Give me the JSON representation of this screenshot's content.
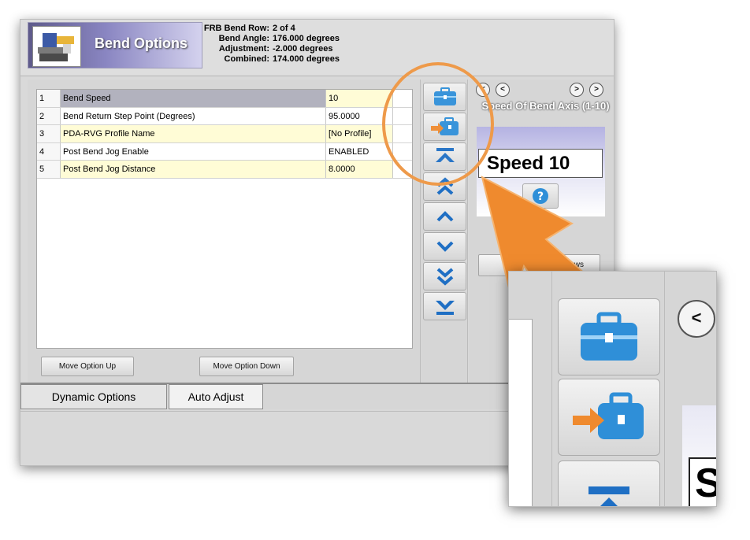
{
  "header": {
    "title": "Bend Options",
    "info": [
      {
        "label": "FRB Bend Row:",
        "value": "2 of 4"
      },
      {
        "label": "Bend Angle:",
        "value": "176.000 degrees"
      },
      {
        "label": "Adjustment:",
        "value": "-2.000 degrees"
      },
      {
        "label": "Combined:",
        "value": "174.000 degrees"
      }
    ]
  },
  "grid": {
    "rows": [
      {
        "num": "1",
        "name": "Bend Speed",
        "value": "10"
      },
      {
        "num": "2",
        "name": "Bend Return Step Point (Degrees)",
        "value": "95.0000"
      },
      {
        "num": "3",
        "name": "PDA-RVG Profile Name",
        "value": "[No Profile]"
      },
      {
        "num": "4",
        "name": "Post Bend Jog Enable",
        "value": "ENABLED"
      },
      {
        "num": "5",
        "name": "Post Bend Jog Distance",
        "value": "8.0000"
      }
    ]
  },
  "buttons": {
    "move_up": "Move Option Up",
    "move_down": "Move Option Down",
    "all_rows": "ll Rows"
  },
  "nav": {
    "prev_label": "<",
    "next_label": ">"
  },
  "param": {
    "title": "Speed Of Bend Axis (1-10)",
    "display": "Speed 10",
    "help": "?"
  },
  "tabs": [
    "Dynamic Options",
    "Auto Adjust"
  ],
  "zoom": {
    "prev_label": "<",
    "speed_fragment": "S"
  },
  "colors": {
    "accent_orange": "#ef8a2e",
    "toolbox_blue": "#2f8fd8",
    "selected_row": "#b2b2be",
    "row_yellow": "#fffcd6"
  }
}
